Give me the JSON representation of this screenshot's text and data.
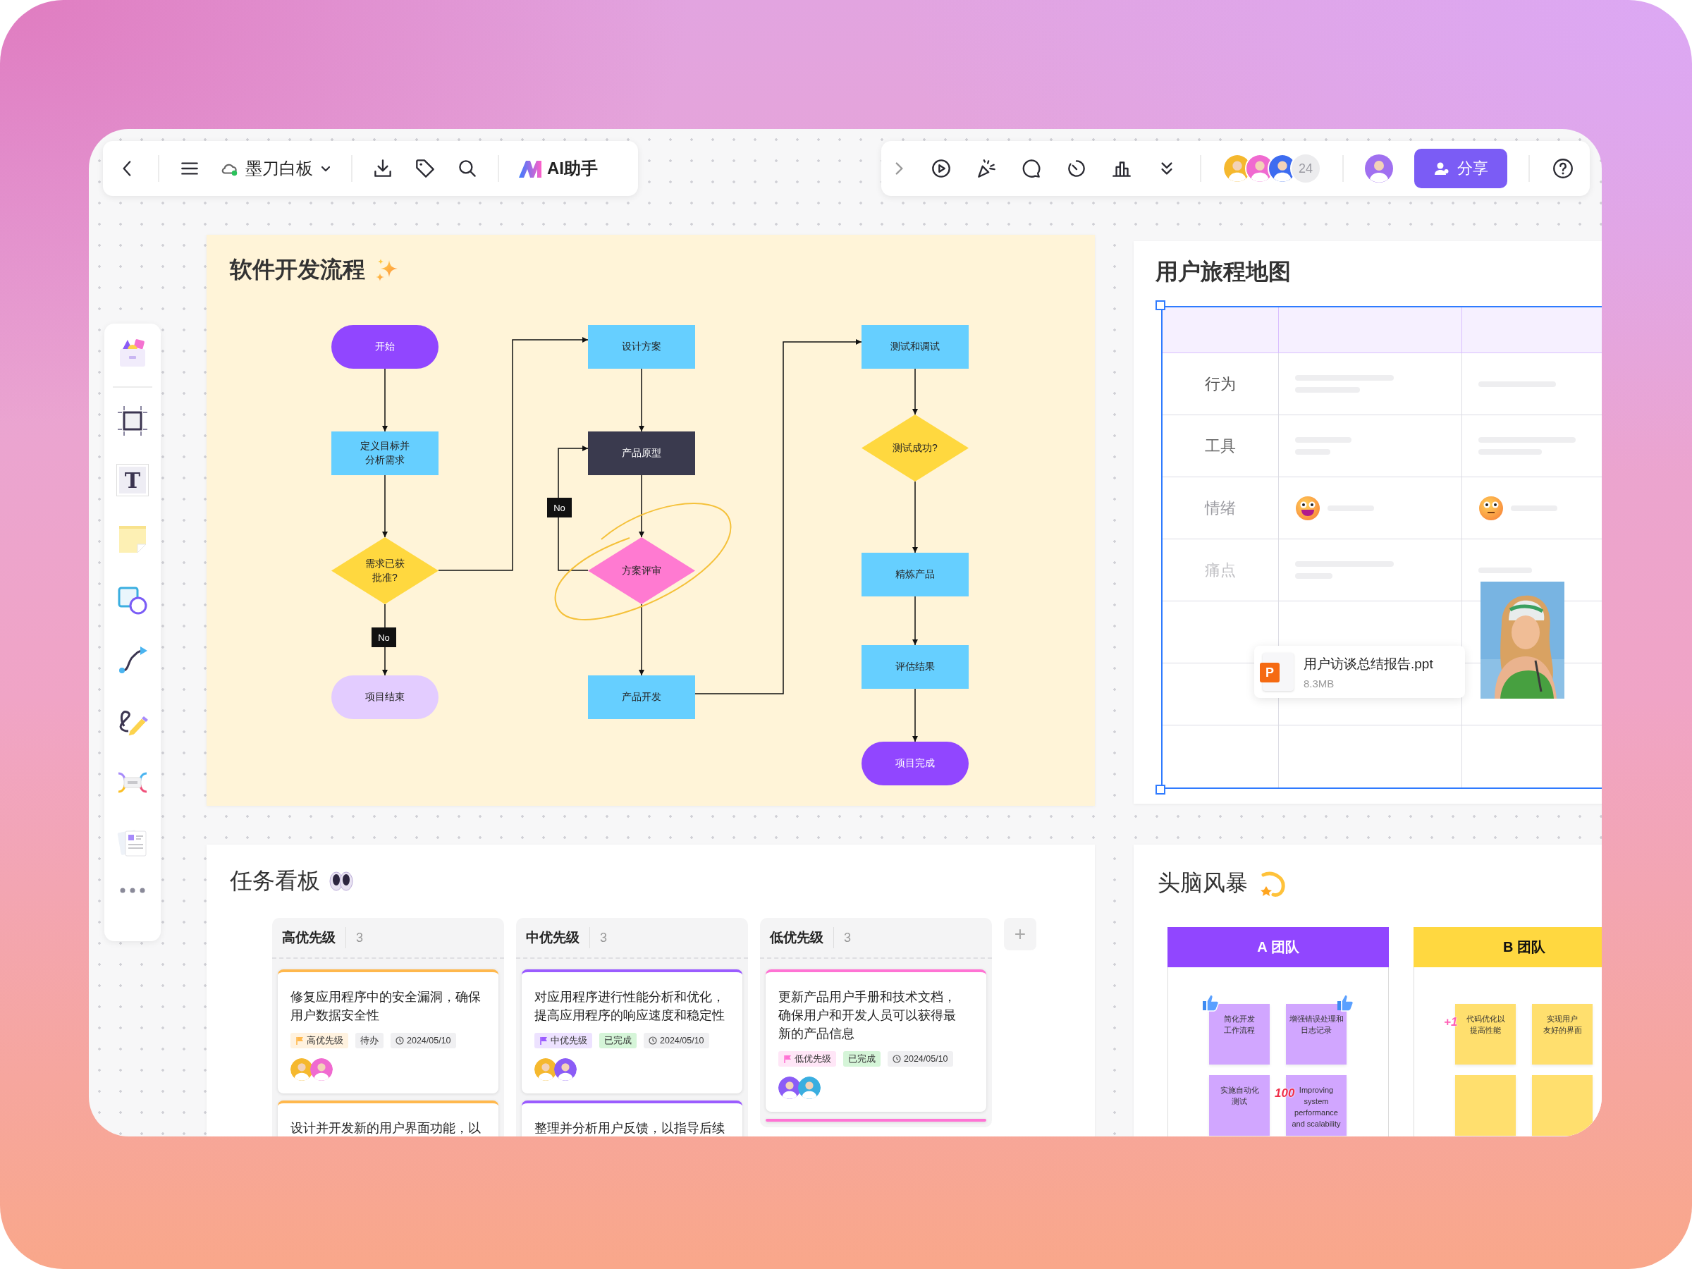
{
  "toolbar_left": {
    "board_name": "墨刀白板",
    "ai_button": "AI助手"
  },
  "toolbar_right": {
    "collaborator_count": "24",
    "share_button": "分享"
  },
  "tools": {
    "text_glyph": "T"
  },
  "flowchart": {
    "title": "软件开发流程",
    "nodes": [
      {
        "kind": "terminal",
        "label": "开始",
        "color": "#9146ff"
      },
      {
        "kind": "process",
        "label": "定义目标并分析需求",
        "color": "#66cfff"
      },
      {
        "kind": "decision",
        "label": "需求已获批准?",
        "color": "#ffd83f"
      },
      {
        "kind": "terminal",
        "label": "项目结束",
        "color": "#e3ccff"
      },
      {
        "kind": "process",
        "label": "设计方案",
        "color": "#66cfff"
      },
      {
        "kind": "process",
        "label": "产品原型",
        "color": "#3a3a4e"
      },
      {
        "kind": "decision",
        "label": "方案评审",
        "color": "#ff7ad1"
      },
      {
        "kind": "process",
        "label": "产品开发",
        "color": "#66cfff"
      },
      {
        "kind": "process",
        "label": "测试和调试",
        "color": "#66cfff"
      },
      {
        "kind": "decision",
        "label": "测试成功?",
        "color": "#ffd83f"
      },
      {
        "kind": "process",
        "label": "精炼产品",
        "color": "#66cfff"
      },
      {
        "kind": "process",
        "label": "评估结果",
        "color": "#66cfff"
      },
      {
        "kind": "terminal",
        "label": "项目完成",
        "color": "#9146ff"
      }
    ],
    "branch_labels": [
      "No",
      "No"
    ]
  },
  "journey_map": {
    "title": "用户旅程地图",
    "rows": [
      {
        "kind": "text",
        "label": "行为"
      },
      {
        "kind": "text",
        "label": "工具"
      },
      {
        "kind": "mood",
        "label": "情绪"
      },
      {
        "kind": "text",
        "label": "痛点"
      },
      {
        "kind": "blank"
      },
      {
        "kind": "blank"
      },
      {
        "kind": "blank"
      }
    ],
    "file": {
      "icon_letter": "P",
      "name": "用户访谈总结报告.ppt",
      "size": "8.3MB"
    }
  },
  "kanban": {
    "title": "任务看板",
    "add_button": "+",
    "columns": [
      {
        "name": "高优先级",
        "count": "3",
        "color": "#ffb84d",
        "cards": [
          {
            "kind": "full",
            "text": "修复应用程序中的安全漏洞，确保用户数据安全性",
            "priority": "高优先级",
            "status": "待办",
            "done": false,
            "date": "2024/05/10"
          },
          {
            "kind": "partial",
            "text": "设计并开发新的用户界面功能，以"
          }
        ]
      },
      {
        "name": "中优先级",
        "count": "3",
        "color": "#9b5cff",
        "cards": [
          {
            "kind": "full",
            "text": "对应用程序进行性能分析和优化，提高应用程序的响应速度和稳定性",
            "priority": "中优先级",
            "status": "已完成",
            "done": true,
            "date": "2024/05/10"
          },
          {
            "kind": "partial",
            "text": "整理并分析用户反馈，以指导后续"
          }
        ]
      },
      {
        "name": "低优先级",
        "count": "3",
        "color": "#ff73d4",
        "cards": [
          {
            "kind": "full",
            "text": "更新产品用户手册和技术文档，确保用户和开发人员可以获得最新的产品信息",
            "priority": "低优先级",
            "status": "已完成",
            "done": true,
            "date": "2024/05/10"
          },
          {
            "kind": "partial"
          }
        ]
      }
    ]
  },
  "brainstorm": {
    "title": "头脑风暴",
    "teams": [
      {
        "name": "A 团队",
        "color": "#9146ff",
        "notes": [
          {
            "lines": [
              "简化开发",
              "工作流程"
            ],
            "color": "#d1a6ff",
            "liked": true
          },
          {
            "lines": [
              "增强错误处理和",
              "日志记录"
            ],
            "color": "#d1a6ff",
            "liked": true
          },
          {
            "lines": [
              "实施自动化",
              "测试"
            ],
            "color": "#d1a6ff",
            "liked": false
          },
          {
            "lines": [
              "Improving",
              "system",
              "performance",
              "and scalability"
            ],
            "color": "#d1a6ff",
            "liked": false,
            "badge": {
              "text": "100",
              "color": "#f0304a"
            }
          }
        ]
      },
      {
        "name": "B 团队",
        "color": "#ffd840",
        "notes": [
          {
            "lines": [
              "代码优化以",
              "提高性能"
            ],
            "color": "#ffdf6e",
            "liked": false,
            "badge": {
              "text": "+1",
              "color": "#ff5fb6"
            }
          },
          {
            "lines": [
              "实现用户",
              "友好的界面"
            ],
            "color": "#ffdf6e",
            "liked": false
          },
          {
            "color": "#ffdf6e",
            "liked": false
          },
          {
            "color": "#ffdf6e",
            "liked": false
          }
        ]
      }
    ]
  }
}
